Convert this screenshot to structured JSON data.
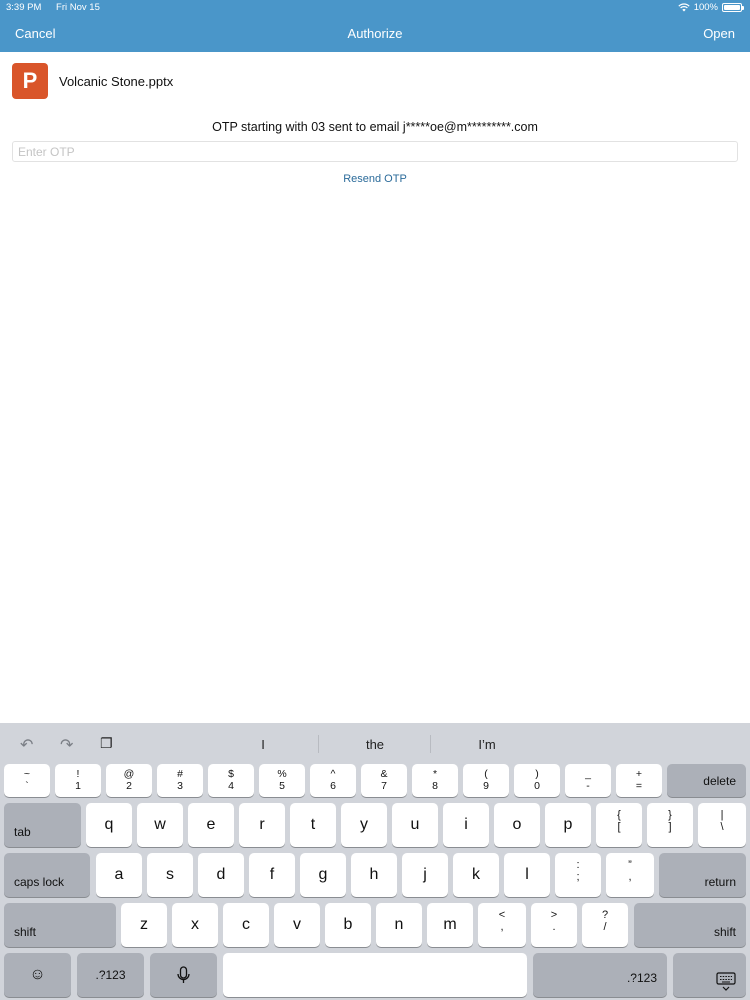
{
  "status": {
    "time": "3:39 PM",
    "date": "Fri Nov 15",
    "battery": "100%"
  },
  "nav": {
    "cancel": "Cancel",
    "title": "Authorize",
    "open": "Open"
  },
  "file": {
    "icon_letter": "P",
    "name": "Volcanic Stone.pptx"
  },
  "otp": {
    "message": "OTP starting with 03 sent to email j*****oe@m*********.com",
    "placeholder": "Enter OTP",
    "resend": "Resend OTP"
  },
  "keyboard": {
    "suggestions": [
      "I",
      "the",
      "I’m"
    ],
    "row1": [
      {
        "top": "~",
        "bot": "`"
      },
      {
        "top": "!",
        "bot": "1"
      },
      {
        "top": "@",
        "bot": "2"
      },
      {
        "top": "#",
        "bot": "3"
      },
      {
        "top": "$",
        "bot": "4"
      },
      {
        "top": "%",
        "bot": "5"
      },
      {
        "top": "^",
        "bot": "6"
      },
      {
        "top": "&",
        "bot": "7"
      },
      {
        "top": "*",
        "bot": "8"
      },
      {
        "top": "(",
        "bot": "9"
      },
      {
        "top": ")",
        "bot": "0"
      },
      {
        "top": "_",
        "bot": "-"
      },
      {
        "top": "+",
        "bot": "="
      }
    ],
    "delete": "delete",
    "tab": "tab",
    "row2": [
      "q",
      "w",
      "e",
      "r",
      "t",
      "y",
      "u",
      "i",
      "o",
      "p"
    ],
    "row2_sym": [
      {
        "top": "{",
        "bot": "["
      },
      {
        "top": "}",
        "bot": "]"
      },
      {
        "top": "|",
        "bot": "\\"
      }
    ],
    "caps": "caps lock",
    "row3": [
      "a",
      "s",
      "d",
      "f",
      "g",
      "h",
      "j",
      "k",
      "l"
    ],
    "row3_sym": [
      {
        "top": ":",
        "bot": ";"
      },
      {
        "top": "”",
        "bot": ","
      }
    ],
    "return": "return",
    "shift": "shift",
    "row4": [
      "z",
      "x",
      "c",
      "v",
      "b",
      "n",
      "m"
    ],
    "row4_sym": [
      {
        "top": "<",
        "bot": ","
      },
      {
        "top": ">",
        "bot": "."
      },
      {
        "top": "?",
        "bot": "/"
      }
    ],
    "numkey": ".?123"
  }
}
